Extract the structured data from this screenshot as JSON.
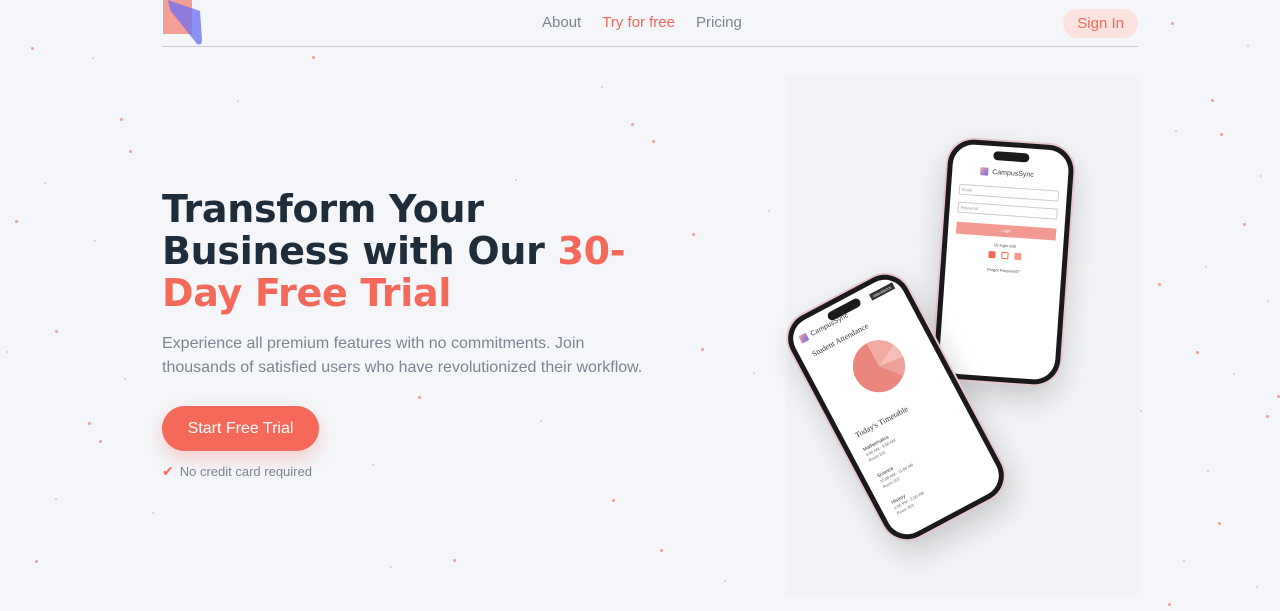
{
  "nav": {
    "links": [
      {
        "label": "About",
        "active": false
      },
      {
        "label": "Try for free",
        "active": true
      },
      {
        "label": "Pricing",
        "active": false
      }
    ],
    "signin": "Sign In"
  },
  "hero": {
    "line1": "Transform Your",
    "line2": "Business with Our",
    "accent1": "30-",
    "accent2": "Day Free Trial",
    "subtitle": "Experience all premium features with no commitments. Join thousands of satisfied users who have revolutionized their workflow.",
    "cta": "Start Free Trial",
    "note": "No credit card required"
  },
  "phone_login": {
    "app_name": "CampusSync",
    "email_placeholder": "Email",
    "password_placeholder": "Password",
    "login_button": "Login",
    "or_login_with": "Or login with",
    "forgot": "Forgot Password?"
  },
  "phone_dashboard": {
    "app_name": "CampusSync",
    "badge": "Attendance",
    "attendance_title": "Student Attendance",
    "timetable_title": "Today's Timetable",
    "classes": [
      {
        "subject": "Mathematics",
        "time": "9:00 AM - 9:50 AM",
        "room": "Room 101"
      },
      {
        "subject": "Science",
        "time": "10:00 AM - 11:00 AM",
        "room": "Room 202"
      },
      {
        "subject": "History",
        "time": "1:00 PM - 2:00 PM",
        "room": "Room 303"
      }
    ]
  },
  "colors": {
    "accent": "#f4695a",
    "heading": "#1f2d3a",
    "muted": "#7c8693",
    "background": "#f4f6f9"
  }
}
